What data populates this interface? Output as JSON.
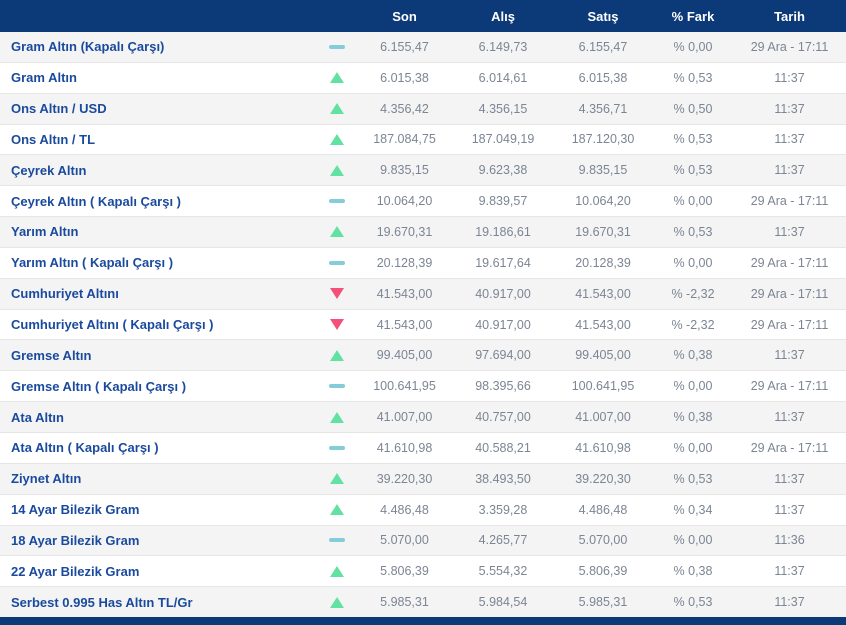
{
  "header": {
    "son": "Son",
    "alis": "Alış",
    "satis": "Satış",
    "fark": "% Fark",
    "tarih": "Tarih"
  },
  "rows": [
    {
      "name": "Gram Altın (Kapalı Çarşı)",
      "trend": "flat",
      "son": "6.155,47",
      "alis": "6.149,73",
      "satis": "6.155,47",
      "fark": "% 0,00",
      "tarih": "29 Ara - 17:11"
    },
    {
      "name": "Gram Altın",
      "trend": "up",
      "son": "6.015,38",
      "alis": "6.014,61",
      "satis": "6.015,38",
      "fark": "% 0,53",
      "tarih": "11:37"
    },
    {
      "name": "Ons Altın / USD",
      "trend": "up",
      "son": "4.356,42",
      "alis": "4.356,15",
      "satis": "4.356,71",
      "fark": "% 0,50",
      "tarih": "11:37"
    },
    {
      "name": "Ons Altın / TL",
      "trend": "up",
      "son": "187.084,75",
      "alis": "187.049,19",
      "satis": "187.120,30",
      "fark": "% 0,53",
      "tarih": "11:37"
    },
    {
      "name": "Çeyrek Altın",
      "trend": "up",
      "son": "9.835,15",
      "alis": "9.623,38",
      "satis": "9.835,15",
      "fark": "% 0,53",
      "tarih": "11:37"
    },
    {
      "name": "Çeyrek Altın ( Kapalı Çarşı )",
      "trend": "flat",
      "son": "10.064,20",
      "alis": "9.839,57",
      "satis": "10.064,20",
      "fark": "% 0,00",
      "tarih": "29 Ara - 17:11"
    },
    {
      "name": "Yarım Altın",
      "trend": "up",
      "son": "19.670,31",
      "alis": "19.186,61",
      "satis": "19.670,31",
      "fark": "% 0,53",
      "tarih": "11:37"
    },
    {
      "name": "Yarım Altın ( Kapalı Çarşı )",
      "trend": "flat",
      "son": "20.128,39",
      "alis": "19.617,64",
      "satis": "20.128,39",
      "fark": "% 0,00",
      "tarih": "29 Ara - 17:11"
    },
    {
      "name": "Cumhuriyet Altını",
      "trend": "down",
      "son": "41.543,00",
      "alis": "40.917,00",
      "satis": "41.543,00",
      "fark": "% -2,32",
      "tarih": "29 Ara - 17:11"
    },
    {
      "name": "Cumhuriyet Altını ( Kapalı Çarşı )",
      "trend": "down",
      "son": "41.543,00",
      "alis": "40.917,00",
      "satis": "41.543,00",
      "fark": "% -2,32",
      "tarih": "29 Ara - 17:11"
    },
    {
      "name": "Gremse Altın",
      "trend": "up",
      "son": "99.405,00",
      "alis": "97.694,00",
      "satis": "99.405,00",
      "fark": "% 0,38",
      "tarih": "11:37"
    },
    {
      "name": "Gremse Altın ( Kapalı Çarşı )",
      "trend": "flat",
      "son": "100.641,95",
      "alis": "98.395,66",
      "satis": "100.641,95",
      "fark": "% 0,00",
      "tarih": "29 Ara - 17:11"
    },
    {
      "name": "Ata Altın",
      "trend": "up",
      "son": "41.007,00",
      "alis": "40.757,00",
      "satis": "41.007,00",
      "fark": "% 0,38",
      "tarih": "11:37"
    },
    {
      "name": "Ata Altın ( Kapalı Çarşı )",
      "trend": "flat",
      "son": "41.610,98",
      "alis": "40.588,21",
      "satis": "41.610,98",
      "fark": "% 0,00",
      "tarih": "29 Ara - 17:11"
    },
    {
      "name": "Ziynet Altın",
      "trend": "up",
      "son": "39.220,30",
      "alis": "38.493,50",
      "satis": "39.220,30",
      "fark": "% 0,53",
      "tarih": "11:37"
    },
    {
      "name": "14 Ayar Bilezik Gram",
      "trend": "up",
      "son": "4.486,48",
      "alis": "3.359,28",
      "satis": "4.486,48",
      "fark": "% 0,34",
      "tarih": "11:37"
    },
    {
      "name": "18 Ayar Bilezik Gram",
      "trend": "flat",
      "son": "5.070,00",
      "alis": "4.265,77",
      "satis": "5.070,00",
      "fark": "% 0,00",
      "tarih": "11:36"
    },
    {
      "name": "22 Ayar Bilezik Gram",
      "trend": "up",
      "son": "5.806,39",
      "alis": "5.554,32",
      "satis": "5.806,39",
      "fark": "% 0,38",
      "tarih": "11:37"
    },
    {
      "name": "Serbest 0.995 Has Altın TL/Gr",
      "trend": "up",
      "son": "5.985,31",
      "alis": "5.984,54",
      "satis": "5.985,31",
      "fark": "% 0,53",
      "tarih": "11:37"
    }
  ],
  "colors": {
    "navy": "#0c3a78",
    "label": "#1a4a9e",
    "value": "#7b8593",
    "row-alt": "#f4f4f4",
    "border": "#e6e6e6",
    "up": "#62e2a2",
    "down": "#f4517a",
    "flat": "#85ccd9"
  }
}
